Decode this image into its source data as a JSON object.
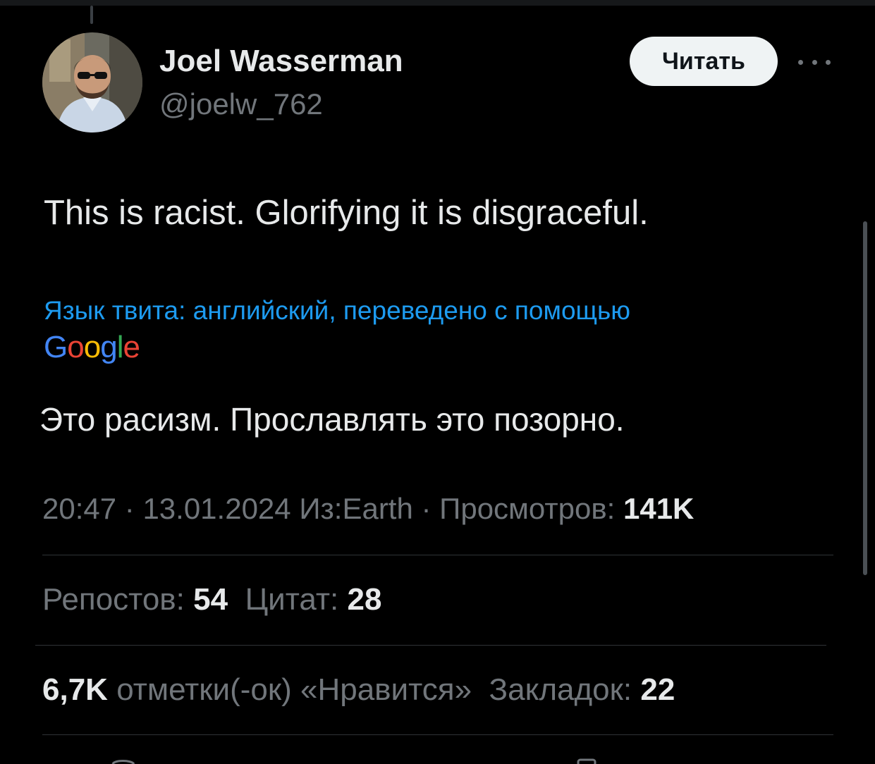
{
  "author": {
    "display_name": "Joel Wasserman",
    "handle": "@joelw_762"
  },
  "follow_button_label": "Читать",
  "tweet": {
    "text": "This is racist. Glorifying it is disgraceful.",
    "translation_note": "Язык твита: английский, переведено с помощью",
    "translation_provider_letters": [
      "G",
      "o",
      "o",
      "g",
      "l",
      "e"
    ],
    "translation_provider_colors": [
      "#4285F4",
      "#EA4335",
      "#FBBC05",
      "#4285F4",
      "#34A853",
      "#EA4335"
    ],
    "translated_text": "Это расизм. Прославлять это позорно."
  },
  "meta": {
    "time": "20:47",
    "date": "13.01.2024",
    "source": "Из:Earth",
    "views_label": "Просмотров:",
    "views_value": "141K"
  },
  "stats": {
    "reposts_label": "Репостов:",
    "reposts_value": "54",
    "quotes_label": "Цитат:",
    "quotes_value": "28",
    "likes_value": "6,7K",
    "likes_label": "отметки(-ок) «Нравится»",
    "bookmarks_label": "Закладок:",
    "bookmarks_value": "22"
  },
  "colors": {
    "background": "#000000",
    "primary_text": "#e7e9ea",
    "secondary_text": "#71767b",
    "link": "#1d9bf0",
    "divider": "#2f3336"
  },
  "icons": [
    "more-icon",
    "avatar"
  ]
}
